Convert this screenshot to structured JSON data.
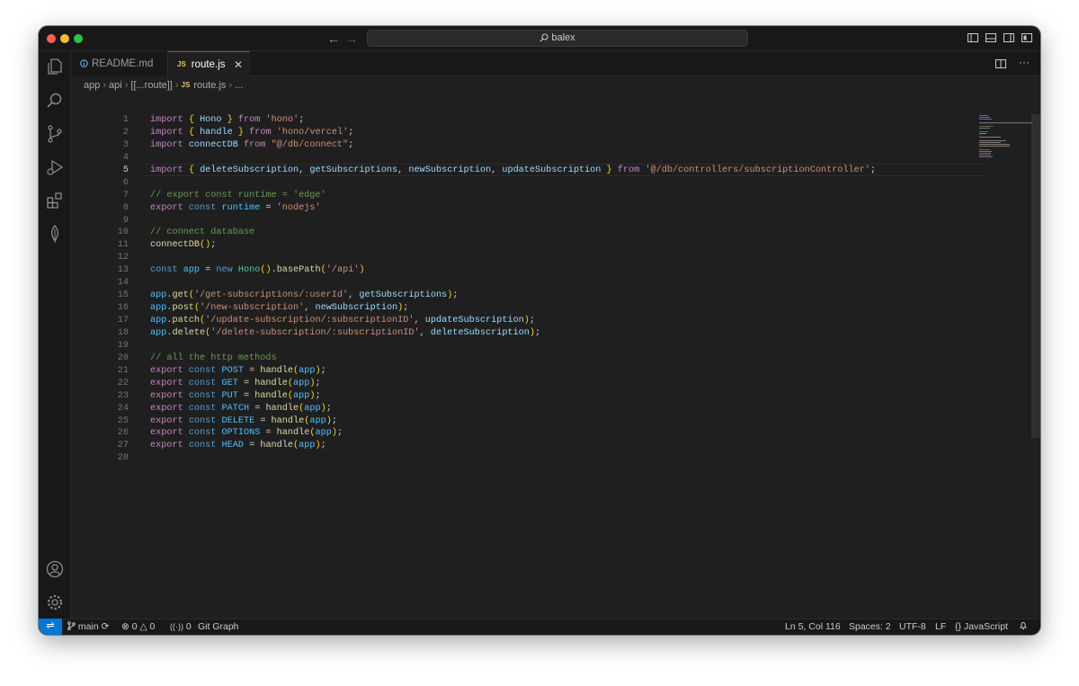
{
  "window": {
    "search_text": "balex"
  },
  "tabs": [
    {
      "label": "README.md",
      "icon": "info-icon"
    },
    {
      "label": "route.js",
      "icon": "js-file-icon",
      "active": true
    }
  ],
  "breadcrumb": [
    "app",
    "api",
    "[[...route]]",
    "route.js",
    "..."
  ],
  "breadcrumb_file_icon": "JS",
  "code_lines": [
    {
      "n": "1",
      "html": "<span class='kw'>import</span> <span class='br'>{</span> <span class='var'>Hono</span> <span class='br'>}</span> <span class='kw'>from</span> <span class='str'>'hono'</span>;"
    },
    {
      "n": "2",
      "html": "<span class='kw'>import</span> <span class='br'>{</span> <span class='var'>handle</span> <span class='br'>}</span> <span class='kw'>from</span> <span class='str'>'hono/vercel'</span>;"
    },
    {
      "n": "3",
      "html": "<span class='kw'>import</span> <span class='var'>connectDB</span> <span class='kw'>from</span> <span class='str'>\"@/db/connect\"</span>;"
    },
    {
      "n": "4",
      "html": ""
    },
    {
      "n": "5",
      "html": "<span class='kw'>import</span> <span class='br'>{</span> <span class='var'>deleteSubscription</span>, <span class='var'>getSubscriptions</span>, <span class='var'>newSubscription</span>, <span class='var'>updateSubscription</span> <span class='br'>}</span> <span class='kw'>from</span> <span class='str'>'@/db/controllers/subscriptionController'</span>;",
      "current": true
    },
    {
      "n": "6",
      "html": ""
    },
    {
      "n": "7",
      "html": "<span class='com'>// export const runtime = 'edge'</span>"
    },
    {
      "n": "8",
      "html": "<span class='kw'>export</span> <span class='kw2'>const</span> <span class='cv'>runtime</span> = <span class='str'>'nodejs'</span>"
    },
    {
      "n": "9",
      "html": ""
    },
    {
      "n": "10",
      "html": "<span class='com'>// connect database</span>"
    },
    {
      "n": "11",
      "html": "<span class='fn'>connectDB</span><span class='br'>()</span>;"
    },
    {
      "n": "12",
      "html": ""
    },
    {
      "n": "13",
      "html": "<span class='kw2'>const</span> <span class='cv'>app</span> = <span class='kw2'>new</span> <span class='cls'>Hono</span><span class='br'>()</span>.<span class='fn'>basePath</span><span class='br'>(</span><span class='str'>'/api'</span><span class='br'>)</span>"
    },
    {
      "n": "14",
      "html": ""
    },
    {
      "n": "15",
      "html": "<span class='cv'>app</span>.<span class='fn'>get</span><span class='br'>(</span><span class='str'>'/get-subscriptions/:userId'</span>, <span class='var'>getSubscriptions</span><span class='br'>)</span>;"
    },
    {
      "n": "16",
      "html": "<span class='cv'>app</span>.<span class='fn'>post</span><span class='br'>(</span><span class='str'>'/new-subscription'</span>, <span class='var'>newSubscription</span><span class='br'>)</span>;"
    },
    {
      "n": "17",
      "html": "<span class='cv'>app</span>.<span class='fn'>patch</span><span class='br'>(</span><span class='str'>'/update-subscription/:subscriptionID'</span>, <span class='var'>updateSubscription</span><span class='br'>)</span>;"
    },
    {
      "n": "18",
      "html": "<span class='cv'>app</span>.<span class='fn'>delete</span><span class='br'>(</span><span class='str'>'/delete-subscription/:subscriptionID'</span>, <span class='var'>deleteSubscription</span><span class='br'>)</span>;"
    },
    {
      "n": "19",
      "html": ""
    },
    {
      "n": "20",
      "html": "<span class='com'>// all the http methods</span>"
    },
    {
      "n": "21",
      "html": "<span class='kw'>export</span> <span class='kw2'>const</span> <span class='cv'>POST</span> = <span class='fn'>handle</span><span class='br'>(</span><span class='cv'>app</span><span class='br'>)</span>;"
    },
    {
      "n": "22",
      "html": "<span class='kw'>export</span> <span class='kw2'>const</span> <span class='cv'>GET</span> = <span class='fn'>handle</span><span class='br'>(</span><span class='cv'>app</span><span class='br'>)</span>;"
    },
    {
      "n": "23",
      "html": "<span class='kw'>export</span> <span class='kw2'>const</span> <span class='cv'>PUT</span> = <span class='fn'>handle</span><span class='br'>(</span><span class='cv'>app</span><span class='br'>)</span>;"
    },
    {
      "n": "24",
      "html": "<span class='kw'>export</span> <span class='kw2'>const</span> <span class='cv'>PATCH</span> = <span class='fn'>handle</span><span class='br'>(</span><span class='cv'>app</span><span class='br'>)</span>;"
    },
    {
      "n": "25",
      "html": "<span class='kw'>export</span> <span class='kw2'>const</span> <span class='cv'>DELETE</span> = <span class='fn'>handle</span><span class='br'>(</span><span class='cv'>app</span><span class='br'>)</span>;"
    },
    {
      "n": "26",
      "html": "<span class='kw'>export</span> <span class='kw2'>const</span> <span class='cv'>OPTIONS</span> = <span class='fn'>handle</span><span class='br'>(</span><span class='cv'>app</span><span class='br'>)</span>;"
    },
    {
      "n": "27",
      "html": "<span class='kw'>export</span> <span class='kw2'>const</span> <span class='cv'>HEAD</span> = <span class='fn'>handle</span><span class='br'>(</span><span class='cv'>app</span><span class='br'>)</span>;"
    },
    {
      "n": "28",
      "html": ""
    }
  ],
  "statusbar": {
    "branch": "main",
    "errors": "0",
    "warnings": "0",
    "ports": "0",
    "git_graph": "Git Graph",
    "cursor": "Ln 5, Col 116",
    "spaces": "Spaces: 2",
    "encoding": "UTF-8",
    "eol": "LF",
    "language": "JavaScript"
  },
  "colors": {
    "accent": "#0078d4",
    "editor_bg": "#1f1f1f",
    "chrome_bg": "#181818"
  }
}
